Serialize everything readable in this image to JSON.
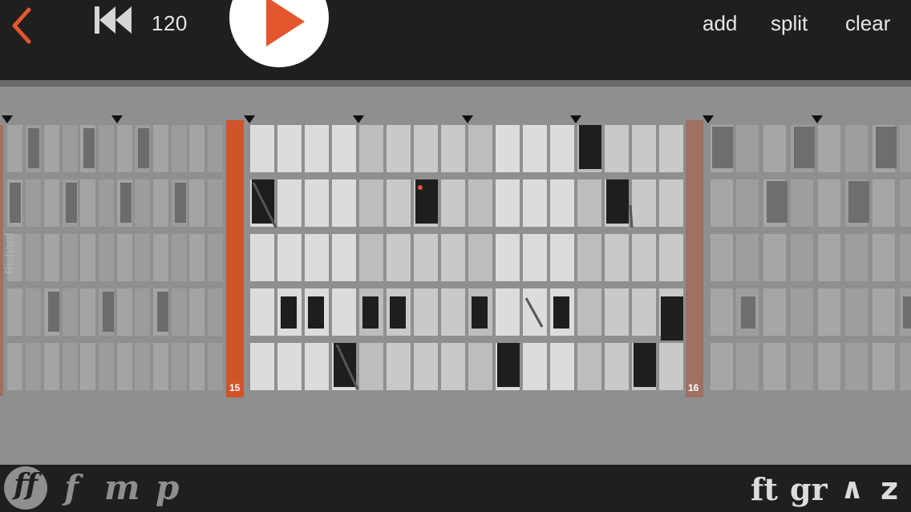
{
  "header": {
    "back_icon": "chevron-left-icon",
    "rewind_icon": "rewind-to-start-icon",
    "tempo": "120",
    "play_icon": "play-icon",
    "actions": {
      "add": "add",
      "split": "split",
      "clear": "clear"
    }
  },
  "colors": {
    "accent": "#e4572e",
    "bar_marker_active": "#d0532a",
    "bar_marker_muted": "#a07060"
  },
  "sequencer": {
    "track_label": "Richard",
    "bars": [
      {
        "number": "15",
        "state": "active"
      },
      {
        "number": "16",
        "state": "inactive"
      }
    ]
  },
  "dynamics": [
    "ff",
    "f",
    "m",
    "p"
  ],
  "selected_dynamic": "ff",
  "articulations": [
    "ft",
    "gr",
    "∧",
    "z"
  ]
}
